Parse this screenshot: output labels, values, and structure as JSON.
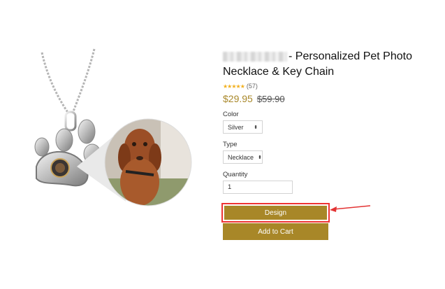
{
  "product": {
    "brand_blurred": "",
    "title_line1": "- Personalized Pet Photo",
    "title_line2": "Necklace & Key Chain",
    "rating_count": "(57)",
    "rating_stars": 5,
    "price": "$29.95",
    "price_old": "$59.90"
  },
  "options": {
    "color_label": "Color",
    "color_value": "Silver",
    "type_label": "Type",
    "type_value": "Necklace",
    "quantity_label": "Quantity",
    "quantity_value": "1"
  },
  "actions": {
    "design_label": "Design",
    "add_to_cart_label": "Add to Cart"
  },
  "colors": {
    "accent": "#a88728",
    "highlight": "#e33333",
    "star": "#f2b01e"
  }
}
